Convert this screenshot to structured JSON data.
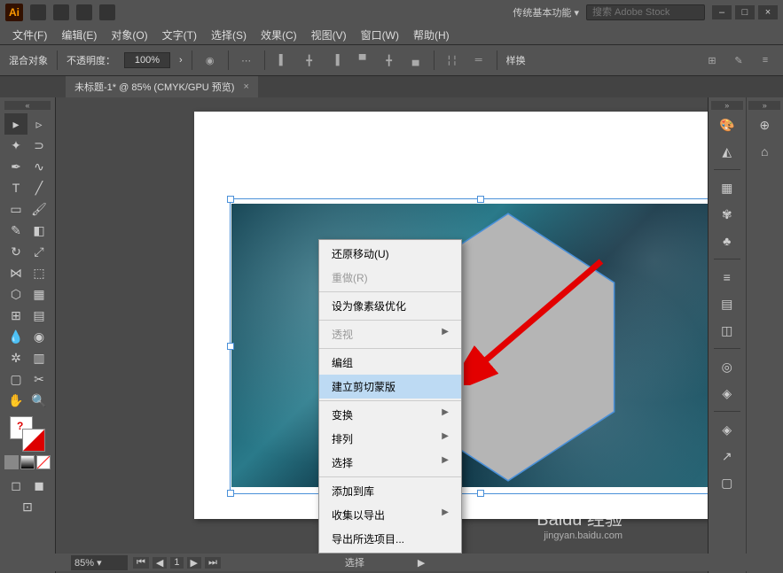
{
  "titlebar": {
    "logo": "Ai",
    "workspace": "传统基本功能",
    "search_placeholder": "搜索 Adobe Stock",
    "min": "–",
    "max": "□",
    "close": "×"
  },
  "menubar": [
    "文件(F)",
    "编辑(E)",
    "对象(O)",
    "文字(T)",
    "选择(S)",
    "效果(C)",
    "视图(V)",
    "窗口(W)",
    "帮助(H)"
  ],
  "ctrlbar": {
    "sel_label": "混合对象",
    "opacity_label": "不透明度：",
    "opacity_value": "100%",
    "style_btn": "样换"
  },
  "tab": {
    "label": "未标题-1* @ 85% (CMYK/GPU 预览)",
    "close": "×"
  },
  "context": [
    {
      "label": "还原移动(U)"
    },
    {
      "label": "重做(R)",
      "disabled": true
    },
    {
      "sep": true
    },
    {
      "label": "设为像素级优化"
    },
    {
      "sep": true
    },
    {
      "label": "透视",
      "disabled": true,
      "sub": true
    },
    {
      "sep": true
    },
    {
      "label": "编组"
    },
    {
      "label": "建立剪切蒙版",
      "highlight": true
    },
    {
      "sep": true
    },
    {
      "label": "变换",
      "sub": true
    },
    {
      "label": "排列",
      "sub": true
    },
    {
      "label": "选择",
      "sub": true
    },
    {
      "sep": true
    },
    {
      "label": "添加到库"
    },
    {
      "label": "收集以导出",
      "sub": true
    },
    {
      "label": "导出所选项目..."
    }
  ],
  "statusbar": {
    "zoom": "85%",
    "page": "1",
    "sel": "选择",
    "navprev": "◀",
    "navnext": "▶"
  },
  "watermark": {
    "main": "Baidu 经验",
    "sub": "jingyan.baidu.com"
  }
}
